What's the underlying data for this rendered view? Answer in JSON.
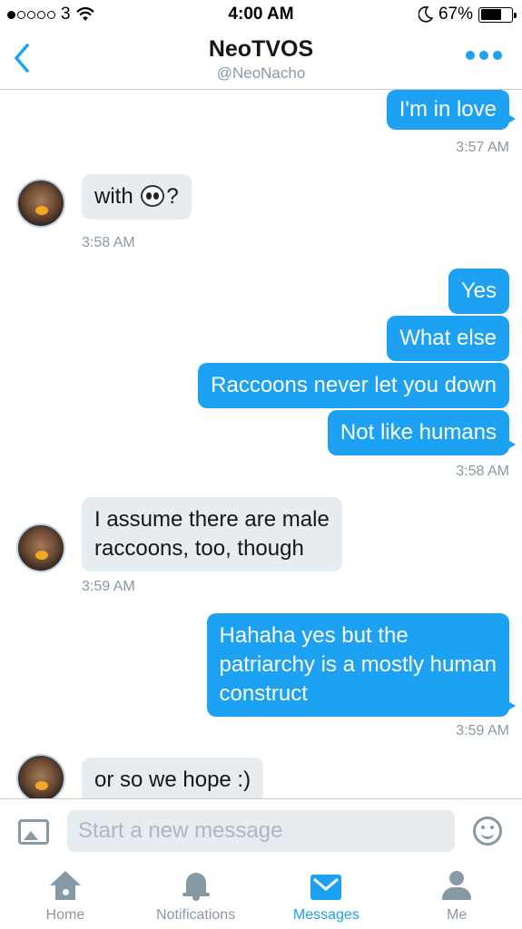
{
  "status_bar": {
    "carrier": "3",
    "time": "4:00 AM",
    "battery": "67%",
    "battery_level": 0.67,
    "signal_dots": 5,
    "signal_filled": 1
  },
  "header": {
    "title": "NeoTVOS",
    "handle": "@NeoNacho",
    "accent": "#1da1f2"
  },
  "messages": {
    "m1": "I'm in love",
    "t1": "3:57 AM",
    "m2": "with",
    "m2_suffix": "?",
    "m2_emoji": "panda-face-icon",
    "t2": "3:58 AM",
    "m3": "Yes",
    "m4": "What else",
    "m5": "Raccoons never let you down",
    "m6": "Not like humans",
    "t3": "3:58 AM",
    "m7_line1": "I assume there are male",
    "m7_line2": "raccoons, too, though",
    "t4": "3:59 AM",
    "m8_line1": "Hahaha yes but the",
    "m8_line2": "patriarchy is a mostly human",
    "m8_line3": "construct",
    "t5": "3:59 AM",
    "m9": "or so we hope :)"
  },
  "composer": {
    "placeholder": "Start a new message"
  },
  "tabs": [
    {
      "label": "Home",
      "icon": "home-icon"
    },
    {
      "label": "Notifications",
      "icon": "bell-icon"
    },
    {
      "label": "Messages",
      "icon": "envelope-icon",
      "active": true
    },
    {
      "label": "Me",
      "icon": "person-icon"
    }
  ],
  "colors": {
    "outgoing_bubble": "#1da1f2",
    "incoming_bubble": "#e6ecf0",
    "muted_text": "#8899a6"
  }
}
